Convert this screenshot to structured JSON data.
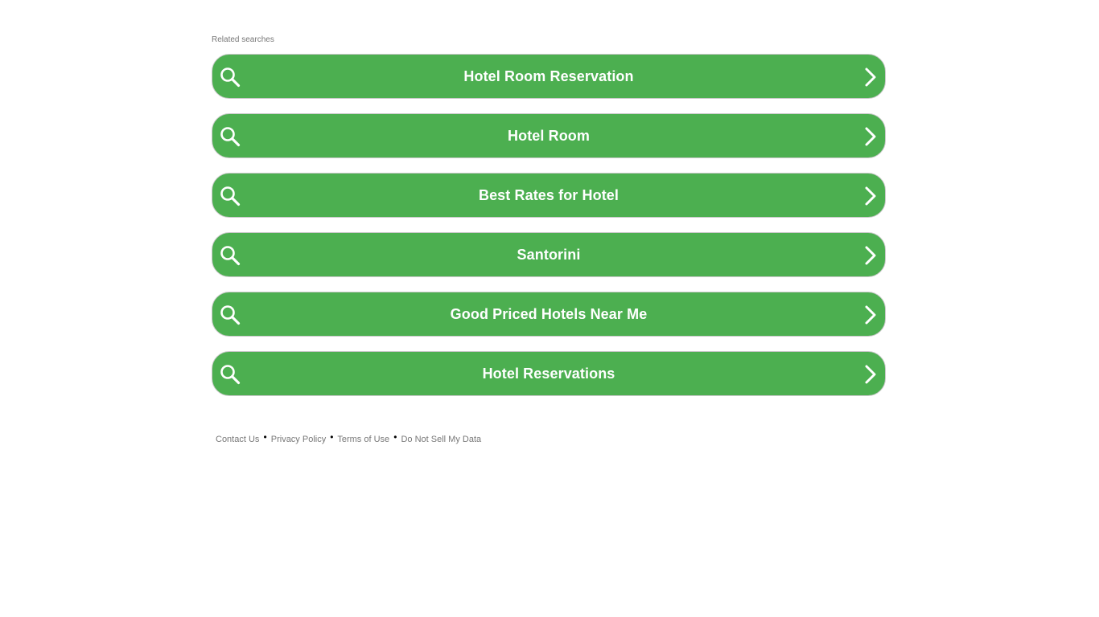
{
  "heading": "Related searches",
  "colors": {
    "button_bg": "#4caf50",
    "button_text": "#ffffff",
    "muted_text": "#777777"
  },
  "results": [
    {
      "label": "Hotel Room Reservation",
      "icon_left": "search-icon",
      "icon_right": "chevron-right-icon"
    },
    {
      "label": "Hotel Room",
      "icon_left": "search-icon",
      "icon_right": "chevron-right-icon"
    },
    {
      "label": "Best Rates for Hotel",
      "icon_left": "search-icon",
      "icon_right": "chevron-right-icon"
    },
    {
      "label": "Santorini",
      "icon_left": "search-icon",
      "icon_right": "chevron-right-icon"
    },
    {
      "label": "Good Priced Hotels Near Me",
      "icon_left": "search-icon",
      "icon_right": "chevron-right-icon"
    },
    {
      "label": "Hotel Reservations",
      "icon_left": "search-icon",
      "icon_right": "chevron-right-icon"
    }
  ],
  "footer": {
    "links": [
      "Contact Us",
      "Privacy Policy",
      "Terms of Use",
      "Do Not Sell My Data"
    ],
    "separator": "•"
  }
}
